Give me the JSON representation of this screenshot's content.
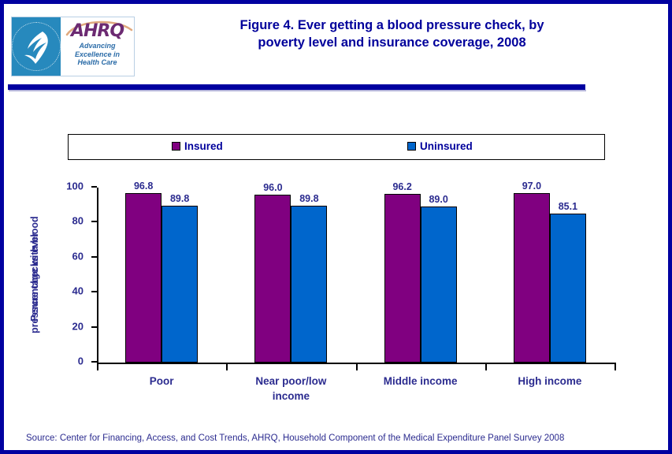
{
  "header": {
    "title_line1": "Figure 4. Ever getting a blood pressure check, by",
    "title_line2": "poverty level and insurance coverage, 2008",
    "logo": {
      "acronym": "AHRQ",
      "tagline_line1": "Advancing",
      "tagline_line2": "Excellence in",
      "tagline_line3": "Health Care",
      "seal_name": "hhs-seal-icon"
    }
  },
  "legend": {
    "entries": [
      {
        "label": "Insured",
        "color": "#800080"
      },
      {
        "label": "Uninsured",
        "color": "#0066CC"
      }
    ]
  },
  "footer": {
    "source": "Source: Center for Financing, Access, and Cost Trends, AHRQ, Household Component of the Medical Expenditure Panel Survey 2008"
  },
  "colors": {
    "frame": "#0000A0",
    "title": "#00009B",
    "text": "#2B2B8F",
    "insured": "#800080",
    "uninsured": "#0066CC"
  },
  "chart_data": {
    "type": "bar",
    "title": "Figure 4. Ever getting a blood pressure check, by poverty level and insurance coverage, 2008",
    "xlabel": "",
    "ylabel": "Percentage with blood pressure checks ever",
    "ylabel_line1": "Percentage with blood",
    "ylabel_line2": "pressure checks ever",
    "ylim": [
      0,
      100
    ],
    "yticks": [
      0,
      20,
      40,
      60,
      80,
      100
    ],
    "ytick_labels": [
      "0",
      "20",
      "40",
      "60",
      "80",
      "100"
    ],
    "grid": false,
    "legend_position": "top",
    "categories": [
      "Poor",
      "Near poor/low income",
      "Middle income",
      "High income"
    ],
    "category_label_lines": [
      [
        "Poor"
      ],
      [
        "Near poor/low",
        "income"
      ],
      [
        "Middle income"
      ],
      [
        "High income"
      ]
    ],
    "series": [
      {
        "name": "Insured",
        "color": "#800080",
        "values": [
          96.8,
          96.0,
          96.2,
          97.0
        ],
        "labels": [
          "96.8",
          "96.0",
          "96.2",
          "97.0"
        ]
      },
      {
        "name": "Uninsured",
        "color": "#0066CC",
        "values": [
          89.8,
          89.8,
          89.0,
          85.1
        ],
        "labels": [
          "89.8",
          "89.8",
          "89.0",
          "85.1"
        ]
      }
    ]
  }
}
